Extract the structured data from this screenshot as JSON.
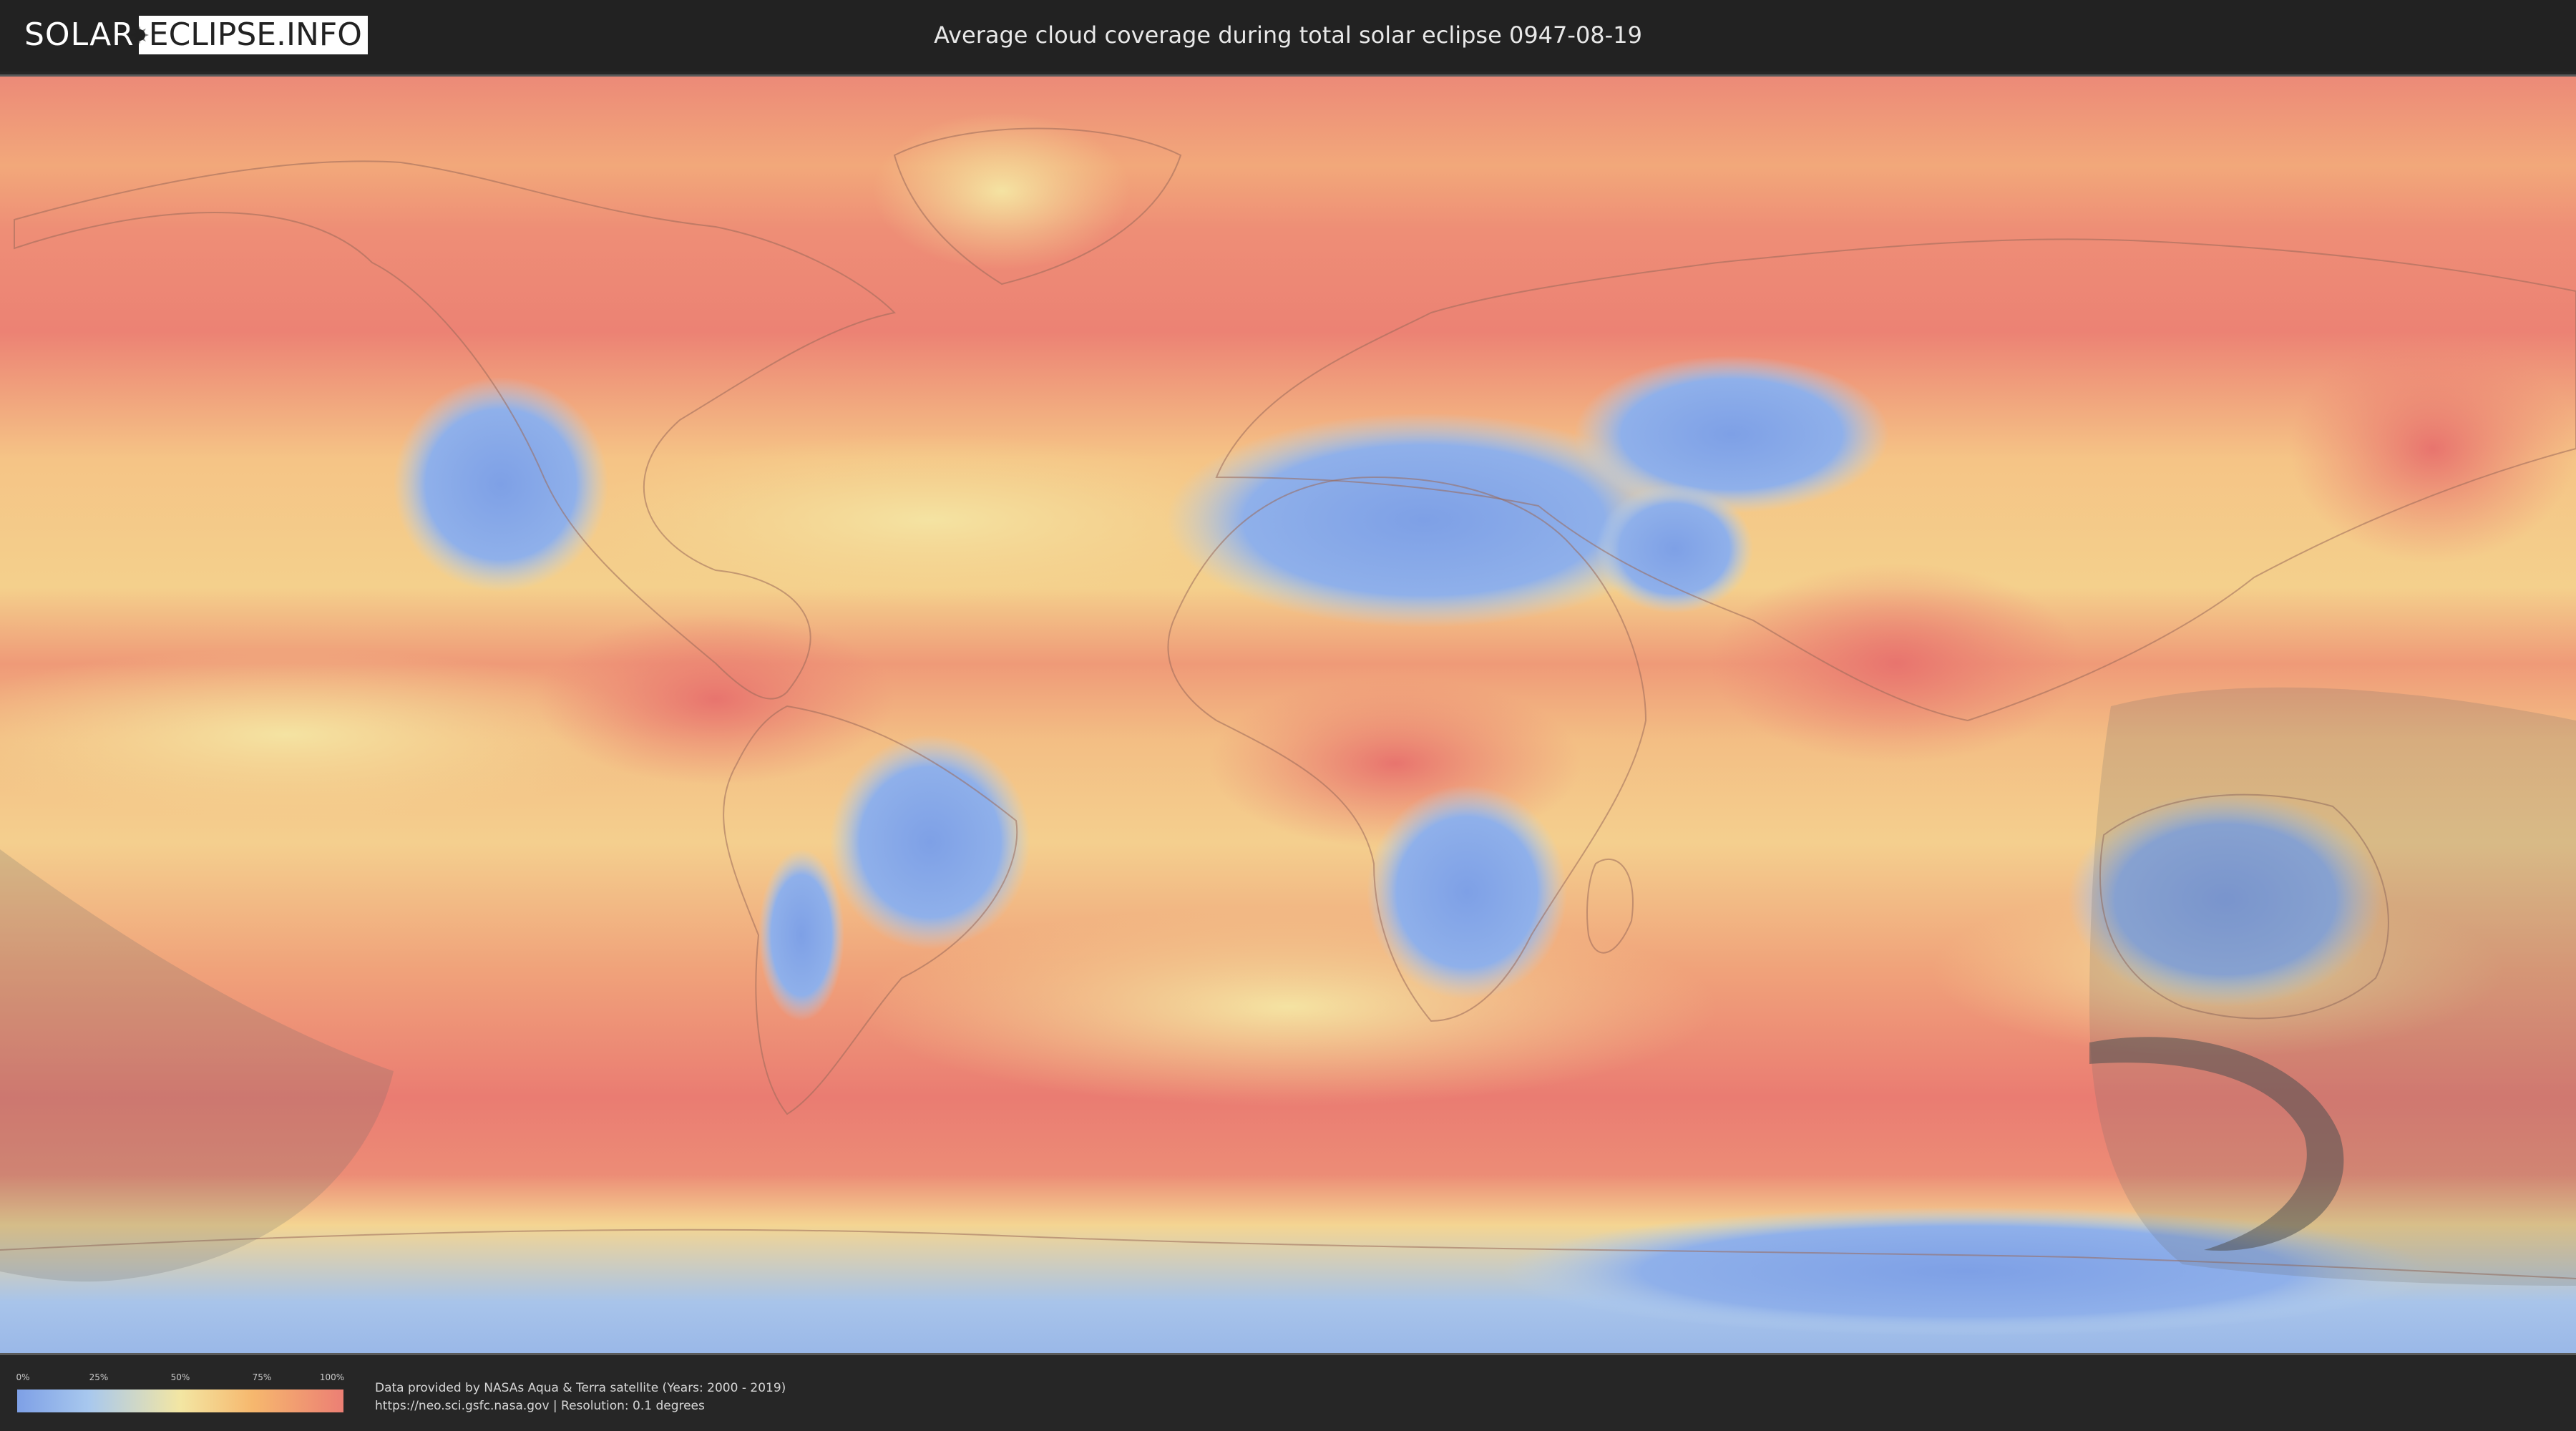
{
  "header": {
    "logo_left": "SOLAR",
    "logo_right": "ECLIPSE.INFO",
    "logo_mark_icon": "moon-sun-icon",
    "title": "Average cloud coverage during total solar eclipse 0947-08-19"
  },
  "map": {
    "type": "world-equirectangular-cloud-coverage",
    "overlay_color": "#6b6b6b",
    "colors": {
      "clear": "#7ea0e6",
      "low": "#a8c8ee",
      "mid": "#f3e6a3",
      "high": "#f6b86e",
      "full": "#ec7f74"
    }
  },
  "legend": {
    "ticks": [
      "0%",
      "25%",
      "50%",
      "75%",
      "100%"
    ]
  },
  "footer": {
    "credit_line1": "Data provided by NASAs Aqua & Terra satellite (Years: 2000 - 2019)",
    "credit_line2": "https://neo.sci.gsfc.nasa.gov | Resolution: 0.1 degrees"
  }
}
